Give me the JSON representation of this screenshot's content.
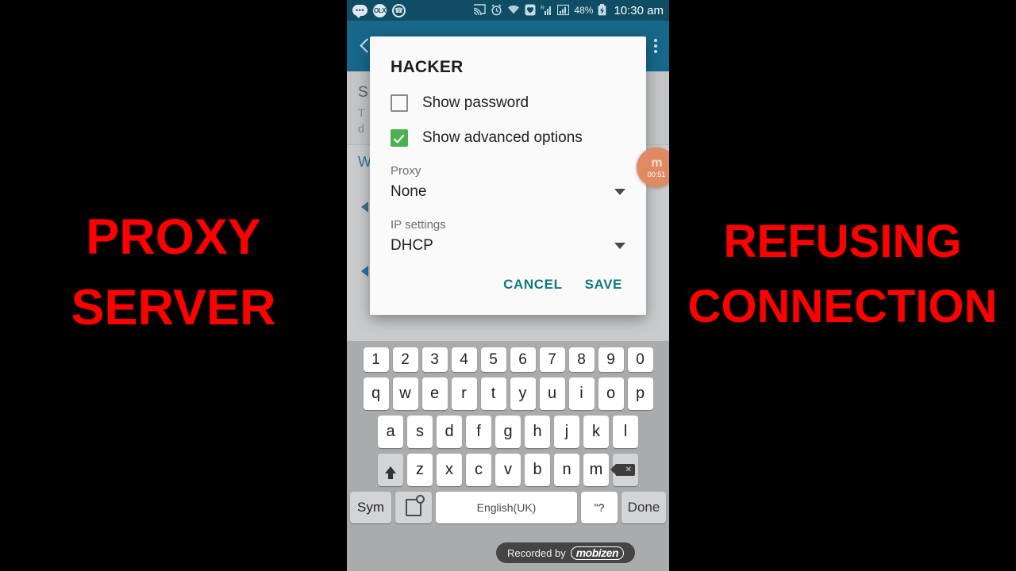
{
  "overlay": {
    "left_caption_line1": "PROXY",
    "left_caption_line2": "SERVER",
    "right_caption_line1": "REFUSING",
    "right_caption_line2": "CONNECTION",
    "caption_color": "#ff0000",
    "background_color": "#000000"
  },
  "statusbar": {
    "background_color": "#0e4d63",
    "icons": [
      "messages-icon",
      "olx-icon",
      "whatsapp-icon",
      "cast-icon",
      "alarm-icon",
      "wifi-icon",
      "health-icon",
      "roaming-signal-icon",
      "signal-bars-icon"
    ],
    "olx_label": "OLX",
    "battery_percent": "48%",
    "battery_icon": "battery-charging-icon",
    "time": "10:30 am"
  },
  "appbar": {
    "background_color": "#17678a",
    "back_icon": "back-arrow-icon",
    "overflow_icon": "overflow-menu-icon"
  },
  "background_screen": {
    "line1": "S",
    "line2": "T",
    "line3": "d",
    "link": "W",
    "arrow1": "collapse-arrow-icon",
    "arrow2": "collapse-arrow-icon"
  },
  "dialog": {
    "title": "HACKER",
    "background_color": "#fafafa",
    "checkboxes": [
      {
        "label": "Show password",
        "checked": false
      },
      {
        "label": "Show advanced options",
        "checked": true
      }
    ],
    "checked_color": "#4caf50",
    "fields": [
      {
        "label": "Proxy",
        "value": "None"
      },
      {
        "label": "IP settings",
        "value": "DHCP"
      }
    ],
    "cancel_label": "CANCEL",
    "save_label": "SAVE",
    "action_color": "#0e7a7f"
  },
  "mobizen_widget": {
    "logo": "m",
    "timer": "00:51",
    "color": "#e08a63"
  },
  "keyboard": {
    "background_color": "#aaabad",
    "number_row": [
      "1",
      "2",
      "3",
      "4",
      "5",
      "6",
      "7",
      "8",
      "9",
      "0"
    ],
    "row1": [
      "q",
      "w",
      "e",
      "r",
      "t",
      "y",
      "u",
      "i",
      "o",
      "p"
    ],
    "row2": [
      "a",
      "s",
      "d",
      "f",
      "g",
      "h",
      "j",
      "k",
      "l"
    ],
    "row3": [
      "z",
      "x",
      "c",
      "v",
      "b",
      "n",
      "m"
    ],
    "shift_icon": "shift-arrow-icon",
    "backspace_icon": "backspace-icon",
    "sym_label": "Sym",
    "settings_icon": "keyboard-settings-icon",
    "space_label": "English(UK)",
    "punct_label": "\"?",
    "done_label": "Done"
  },
  "watermark": {
    "text": "Recorded by",
    "logo": "mobizen"
  }
}
